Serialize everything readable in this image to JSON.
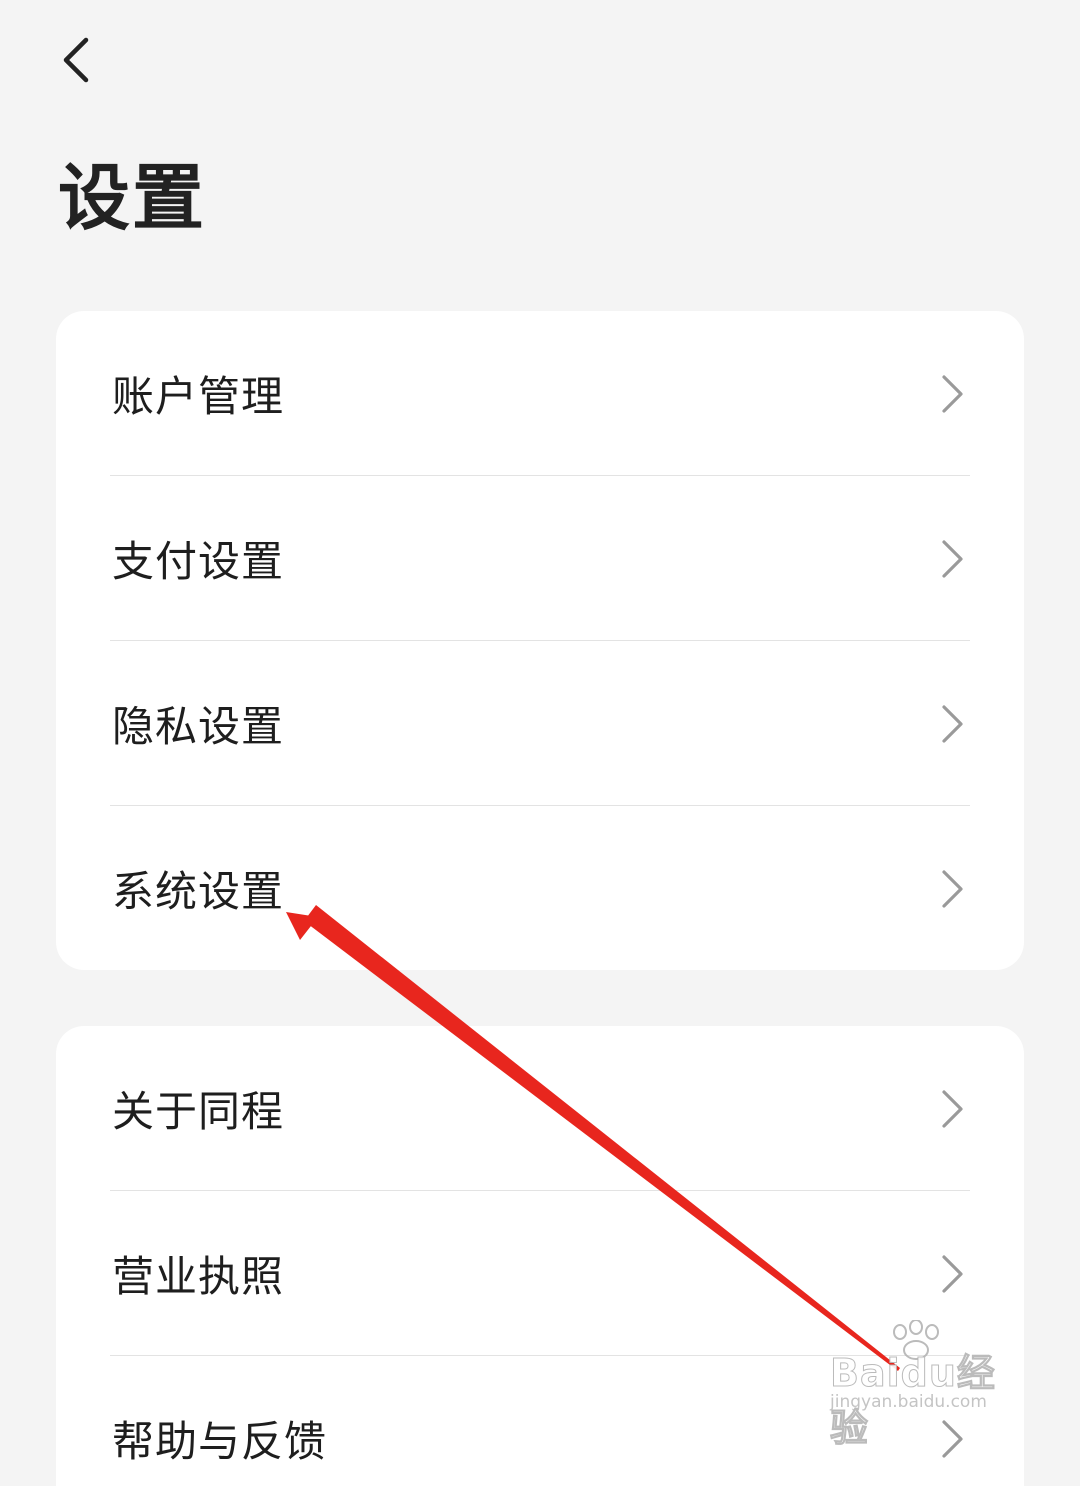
{
  "header": {
    "back_icon": "chevron-left-icon",
    "title": "设置"
  },
  "groups": [
    {
      "items": [
        {
          "label": "账户管理",
          "icon": "chevron-right-icon"
        },
        {
          "label": "支付设置",
          "icon": "chevron-right-icon"
        },
        {
          "label": "隐私设置",
          "icon": "chevron-right-icon"
        },
        {
          "label": "系统设置",
          "icon": "chevron-right-icon"
        }
      ]
    },
    {
      "items": [
        {
          "label": "关于同程",
          "icon": "chevron-right-icon"
        },
        {
          "label": "营业执照",
          "icon": "chevron-right-icon"
        },
        {
          "label": "帮助与反馈",
          "icon": "chevron-right-icon"
        }
      ]
    }
  ],
  "annotation": {
    "type": "arrow",
    "color": "#e8261e",
    "target": "系统设置"
  },
  "watermark": {
    "brand": "Baidu经验",
    "url": "jingyan.baidu.com"
  },
  "colors": {
    "background": "#f4f4f4",
    "card": "#ffffff",
    "text": "#1e1e1e",
    "chevron": "#9a9a9a",
    "divider": "#e3e3e3"
  }
}
